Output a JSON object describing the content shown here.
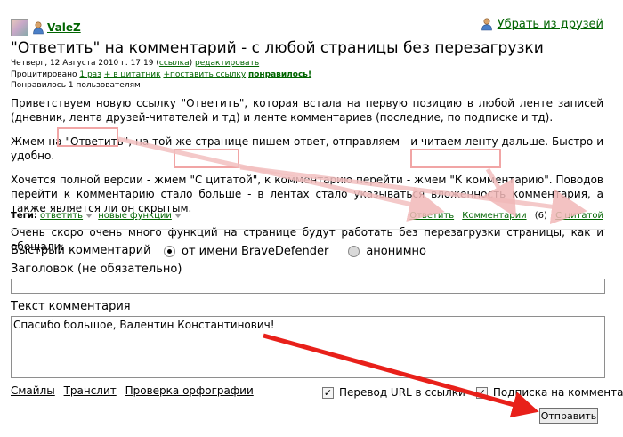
{
  "author": {
    "name": "ValeZ"
  },
  "header": {
    "remove_friend": "Убрать из друзей"
  },
  "post": {
    "title": "\"Ответить\" на комментарий - с любой страницы без перезагрузки",
    "date": "Четверг, 12 Августа 2010 г. 17:19",
    "link_label": "ссылка",
    "edit_label": "редактировать",
    "quoted_label": "Процитировано",
    "quoted_count": "1 раз",
    "to_quotes": "+ в цитатник",
    "post_link": "+поставить ссылку",
    "liked": "понравилось!",
    "liked_by": "Понравилось 1 пользователям",
    "paragraphs": [
      "Приветствуем новую ссылку \"Ответить\", которая встала на первую позицию в любой ленте записей (дневник, лента друзей-читателей и тд) и ленте комментариев (последние, по подписке и тд).",
      "Жмем на \"Ответить\", на той же странице пишем ответ, отправляем - и читаем ленту дальше. Быстро и удобно.",
      "Хочется полной версии - жмем \"С цитатой\", к комментарию перейти - жмем \"К комментарию\". Поводов перейти к комментарию стало больше - в лентах стало указываться вложенность комментария, а также является ли он скрытым.",
      "Очень скоро очень много функций на странице будут работать без перезагрузки страницы, как и обещали."
    ]
  },
  "tags": {
    "label": "Теги:",
    "items": [
      "ответить",
      "новые функции"
    ]
  },
  "actions": {
    "reply": "Ответить",
    "comments": "Комментарии",
    "comments_count": "(6)",
    "with_quote": "С цитатой"
  },
  "quick_comment": {
    "title": "Быстрый комментарий",
    "as_user": "от имени BraveDefender",
    "anonymous": "анонимно",
    "subject_label": "Заголовок",
    "subject_hint": "(не обязательно)",
    "subject_value": "",
    "text_label": "Текст комментария",
    "text_value": "Спасибо большое, Валентин Константинович!",
    "smileys": "Смайлы",
    "translit": "Транслит",
    "spellcheck": "Проверка орфографии",
    "url_to_links": "Перевод URL в ссылки",
    "subscribe": "Подписка на комментарии",
    "submit": "Отправить"
  },
  "colors": {
    "link": "#006400",
    "annotation_box": "#f1a5a5",
    "annotation_arrow": "#e8201a"
  }
}
